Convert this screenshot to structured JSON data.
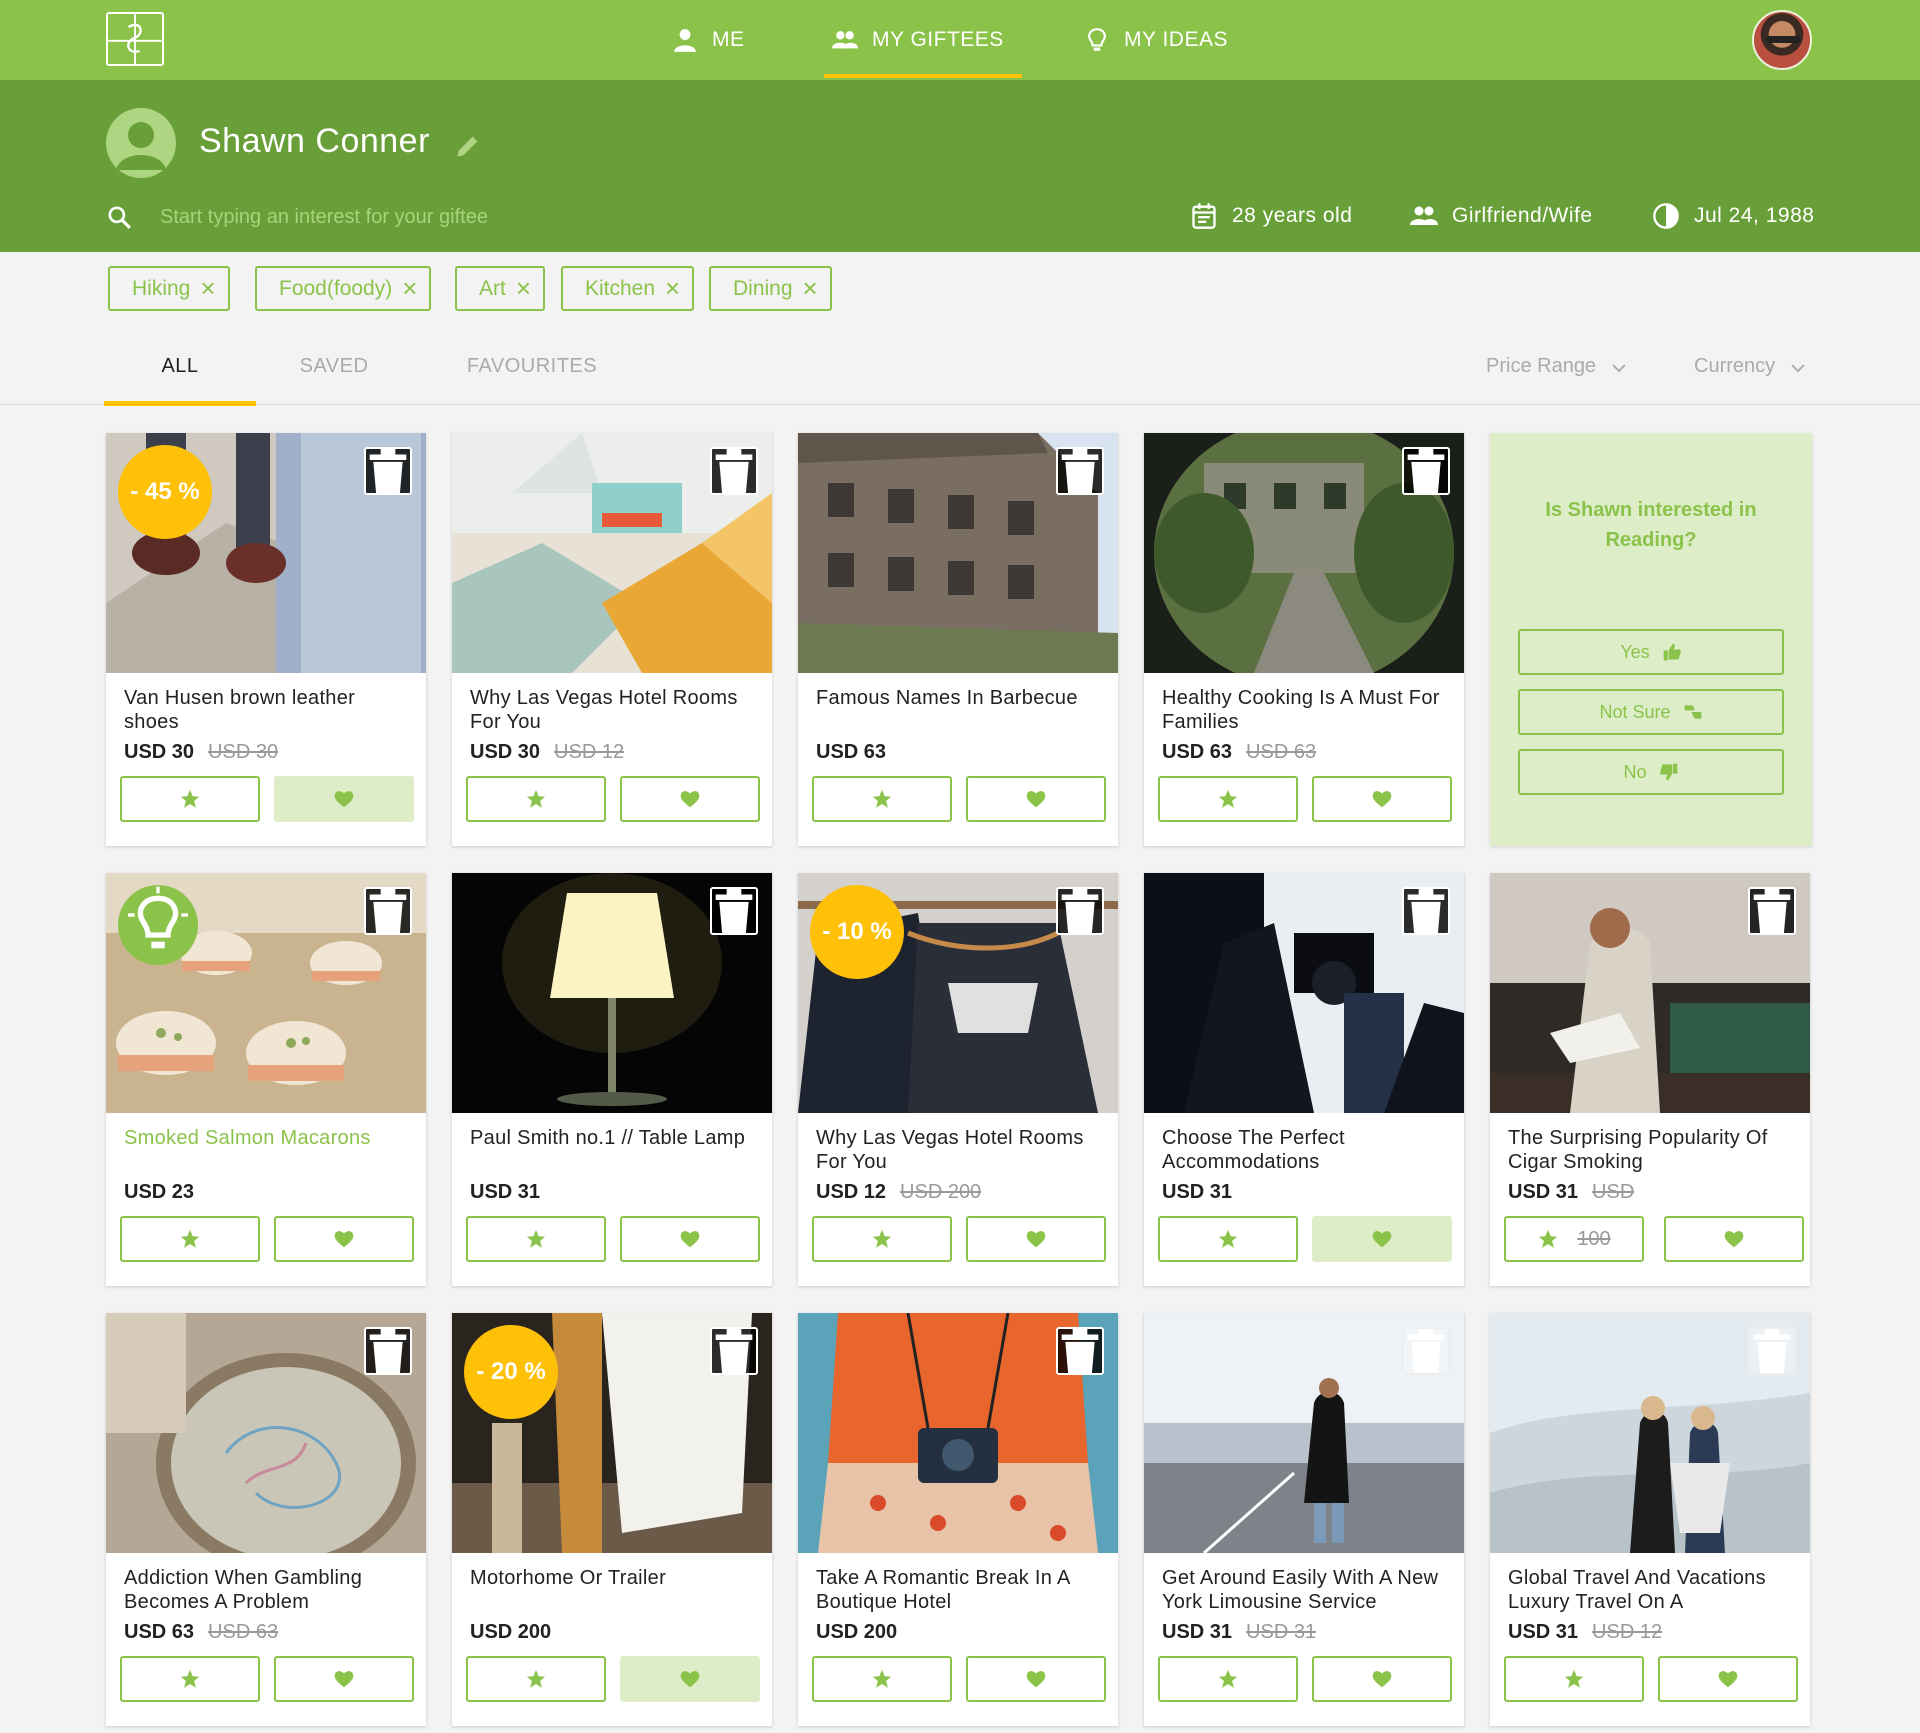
{
  "nav": {
    "me": "ME",
    "giftees": "MY GIFTEES",
    "ideas": "MY IDEAS"
  },
  "giftee": {
    "name": "Shawn Conner",
    "search_placeholder": "Start typing an interest for your giftee",
    "age": "28 years old",
    "relation": "Girlfriend/Wife",
    "birthday": "Jul 24, 1988"
  },
  "tags": [
    "Hiking",
    "Food(foody)",
    "Art",
    "Kitchen",
    "Dining"
  ],
  "tabs": [
    "ALL",
    "SAVED",
    "FAVOURITES"
  ],
  "filters": {
    "price_range": "Price Range",
    "currency": "Currency"
  },
  "question": {
    "text": "Is Shawn interested in Reading?",
    "yes": "Yes",
    "not_sure": "Not Sure",
    "no": "No"
  },
  "cards": [
    {
      "title": "Van Husen brown leather shoes",
      "price": "USD 30",
      "old_price": "USD 30",
      "discount": "- 45 %",
      "heart_active": true
    },
    {
      "title": "Why Las Vegas Hotel Rooms For You",
      "price": "USD 30",
      "old_price": "USD 12"
    },
    {
      "title": "Famous Names In Barbecue",
      "price": "USD 63",
      "old_price": ""
    },
    {
      "title": "Healthy Cooking Is A Must For Families",
      "price": "USD 63",
      "old_price": "USD 63"
    },
    {
      "title": "Smoked Salmon Macarons",
      "price": "USD 23",
      "old_price": "",
      "idea": true
    },
    {
      "title": "Paul Smith no.1 // Table Lamp",
      "price": "USD 31",
      "old_price": ""
    },
    {
      "title": "Why Las Vegas Hotel Rooms For You",
      "price": "USD 12",
      "old_price": "USD 200",
      "discount": "- 10 %"
    },
    {
      "title": "Choose The Perfect Accommodations",
      "price": "USD 31",
      "old_price": "",
      "heart_active": true
    },
    {
      "title": "The Surprising Popularity Of Cigar Smoking",
      "price": "USD 31",
      "old_price": "USD",
      "star_extra": "100"
    },
    {
      "title": "Addiction When Gambling Becomes A Problem",
      "price": "USD 63",
      "old_price": "USD 63"
    },
    {
      "title": "Motorhome Or Trailer",
      "price": "USD 200",
      "old_price": "",
      "discount": "- 20 %",
      "heart_active": true
    },
    {
      "title": "Take A Romantic Break In A Boutique Hotel",
      "price": "USD 200",
      "old_price": ""
    },
    {
      "title": "Get Around Easily With A New York Limousine Service",
      "price": "USD 31",
      "old_price": "USD 31"
    },
    {
      "title": "Global Travel And Vacations Luxury Travel On A",
      "price": "USD 31",
      "old_price": "USD 12"
    }
  ],
  "colors": {
    "primary": "#8bc34a",
    "primary_dark": "#689f38",
    "accent": "#ffc107",
    "light_green": "#dcedc8"
  }
}
